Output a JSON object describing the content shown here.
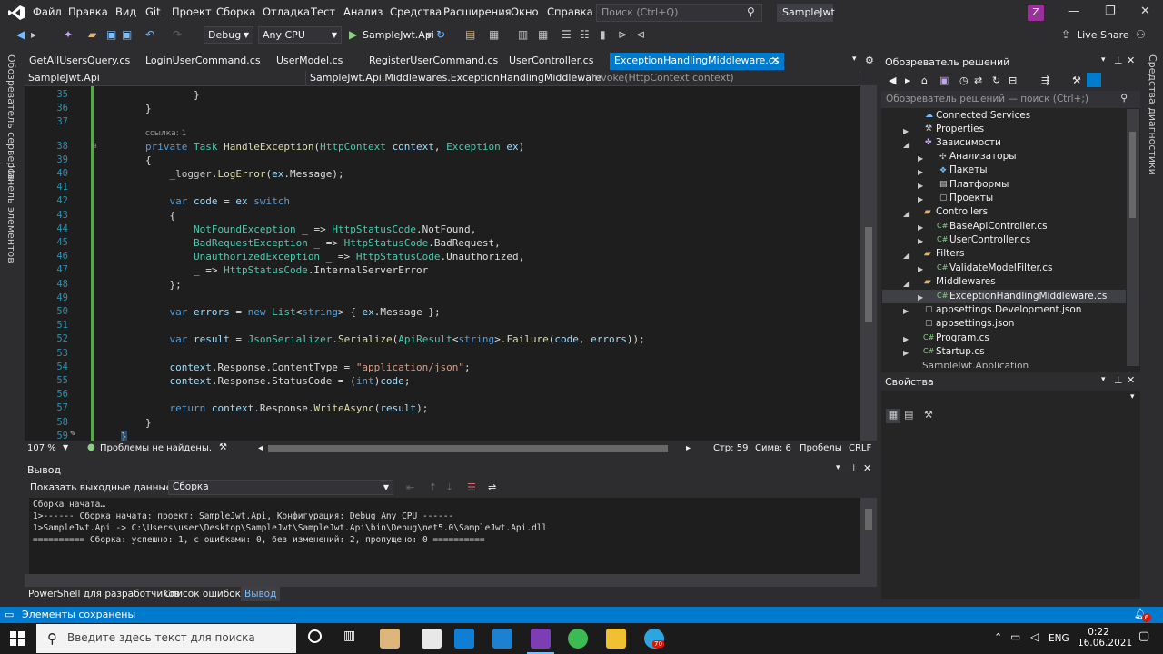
{
  "menu": [
    "Файл",
    "Правка",
    "Вид",
    "Git",
    "Проект",
    "Сборка",
    "Отладка",
    "Тест",
    "Анализ",
    "Средства",
    "Расширения",
    "Окно",
    "Справка"
  ],
  "search_placeholder": "Поиск (Ctrl+Q)",
  "solution_title": "SampleJwt",
  "avatar_letter": "Z",
  "toolbar": {
    "config": "Debug",
    "platform": "Any CPU",
    "run_target": "SampleJwt.Api",
    "live_share": "Live Share"
  },
  "left_strip": [
    "Обозреватель серверов",
    "Панель элементов"
  ],
  "right_strip": "Средства диагностики",
  "tabs": [
    "GetAllUsersQuery.cs",
    "LoginUserCommand.cs",
    "UserModel.cs",
    "RegisterUserCommand.cs",
    "UserController.cs",
    "ExceptionHandlingMiddleware.cs"
  ],
  "nav": {
    "project": "SampleJwt.Api",
    "class": "SampleJwt.Api.Middlewares.ExceptionHandlingMiddleware",
    "member": "Invoke(HttpContext context)"
  },
  "editor": {
    "ref_hint": "ссылка: 1",
    "lines": [
      "35",
      "36",
      "37",
      "38",
      "39",
      "40",
      "41",
      "42",
      "43",
      "44",
      "45",
      "46",
      "47",
      "48",
      "49",
      "50",
      "51",
      "52",
      "53",
      "54",
      "55",
      "56",
      "57",
      "58",
      "59"
    ]
  },
  "editor_status": {
    "zoom": "107 %",
    "issues": "Проблемы не найдены.",
    "line": "Стр: 59",
    "col": "Симв: 6",
    "spaces": "Пробелы",
    "eol": "CRLF"
  },
  "output": {
    "title": "Вывод",
    "source_label": "Показать выходные данные из:",
    "source": "Сборка",
    "lines": [
      "Сборка начата…",
      "1>------ Сборка начата: проект: SampleJwt.Api, Конфигурация: Debug Any CPU ------",
      "1>SampleJwt.Api -> C:\\Users\\user\\Desktop\\SampleJwt\\SampleJwt.Api\\bin\\Debug\\net5.0\\SampleJwt.Api.dll",
      "========== Сборка: успешно: 1, с ошибками: 0, без изменений: 2, пропущено: 0 =========="
    ]
  },
  "bottom_tabs": [
    "PowerShell для разработчиков",
    "Список ошибок...",
    "Вывод"
  ],
  "solution_explorer": {
    "title": "Обозреватель решений",
    "search": "Обозреватель решений — поиск (Ctrl+;)",
    "items": [
      "Connected Services",
      "Properties",
      "Зависимости",
      "Анализаторы",
      "Пакеты",
      "Платформы",
      "Проекты",
      "Controllers",
      "BaseApiController.cs",
      "UserController.cs",
      "Filters",
      "ValidateModelFilter.cs",
      "Middlewares",
      "ExceptionHandlingMiddleware.cs",
      "appsettings.Development.json",
      "appsettings.json",
      "Program.cs",
      "Startup.cs",
      "SampleJwt.Application"
    ]
  },
  "properties_title": "Свойства",
  "status": "Элементы сохранены",
  "notif_count": "6",
  "taskbar": {
    "search": "Введите здесь текст для поиска",
    "lang": "ENG",
    "time": "0:22",
    "date": "16.06.2021",
    "badge": "70"
  }
}
